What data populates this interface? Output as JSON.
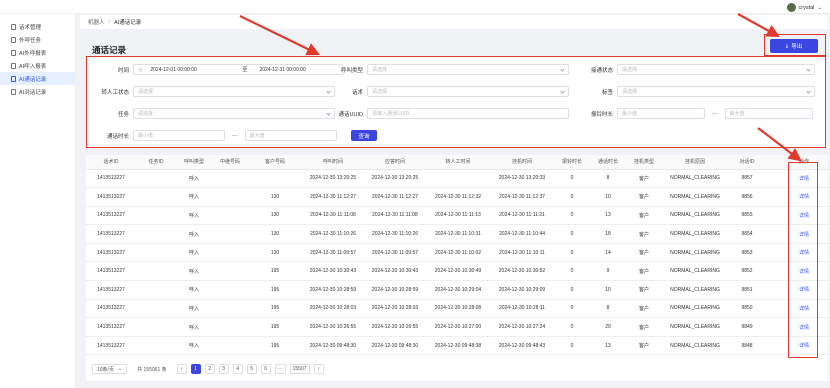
{
  "user": {
    "name": "crystal"
  },
  "sidebar": {
    "items": [
      {
        "label": "话术管理",
        "active": false
      },
      {
        "label": "外呼任务",
        "active": false
      },
      {
        "label": "AI外呼报表",
        "active": false
      },
      {
        "label": "AI呼入报表",
        "active": false
      },
      {
        "label": "AI通话记录",
        "active": true
      },
      {
        "label": "AI对话记录",
        "active": false
      }
    ]
  },
  "breadcrumb": {
    "root": "机器人",
    "sep": "/",
    "current": "AI通话记录"
  },
  "page": {
    "title": "通话记录",
    "export_label": "导出"
  },
  "filters": {
    "time_label": "时间",
    "time_start": "2024-12-01 00:00:00",
    "time_to": "至",
    "time_end": "2024-12-31 00:00:00",
    "call_type_label": "呼叫类型",
    "call_type_ph": "请选择",
    "connect_state_label": "接通状态",
    "connect_state_ph": "请选择",
    "transfer_state_label": "转人工状态",
    "transfer_state_ph": "请选择",
    "script_label": "话术",
    "script_ph": "请选择",
    "tag_label": "标签",
    "tag_ph": "请选择",
    "task_label": "任务",
    "task_ph": "请选择",
    "uuid_label": "通话UUID",
    "uuid_ph": "请输入通话UUID",
    "ring_label": "振铃时长",
    "ring_min_ph": "最小值",
    "ring_max_ph": "最大值",
    "dash": "—",
    "duration_label": "通话时长",
    "dur_min_ph": "最小值",
    "dur_max_ph": "最大值",
    "query_label": "查询"
  },
  "table": {
    "headers": [
      "话术ID",
      "任务ID",
      "呼叫类型",
      "中继号码",
      "客户号码",
      "呼叫时间",
      "应答时间",
      "转人工时间",
      "挂机时间",
      "振铃时长",
      "通话时长",
      "挂机类型",
      "挂机原因",
      "对话ID",
      "",
      "操作"
    ],
    "rows": [
      [
        "1413513227",
        "",
        "呼入",
        "",
        "",
        "2024-12-30 13:20:25",
        "2024-12-30 13:20:25",
        "",
        "2024-12-30 13:20:33",
        "0",
        "8",
        "客户",
        "NORMAL_CLEARING",
        "9857",
        "",
        "详情"
      ],
      [
        "1413513227",
        "",
        "呼入",
        "",
        "130",
        "2024-12-30 11:12:27",
        "2024-12-30 11:12:27",
        "2024-12-30 11:12:32",
        "2024-12-30 11:12:37",
        "0",
        "10",
        "客户",
        "NORMAL_CLEARING",
        "9856",
        "",
        "详情"
      ],
      [
        "1413513227",
        "",
        "呼入",
        "",
        "130",
        "2024-12-30 11:11:08",
        "2024-12-30 11:11:08",
        "2024-12-30 11:11:13",
        "2024-12-30 11:11:21",
        "0",
        "13",
        "客户",
        "NORMAL_CLEARING",
        "9855",
        "",
        "详情"
      ],
      [
        "1413513227",
        "",
        "呼入",
        "",
        "130",
        "2024-12-30 11:10:26",
        "2024-12-30 11:10:26",
        "2024-12-30 11:10:31",
        "2024-12-30 11:10:44",
        "0",
        "18",
        "客户",
        "NORMAL_CLEARING",
        "9854",
        "",
        "详情"
      ],
      [
        "1413513227",
        "",
        "呼入",
        "",
        "130",
        "2024-12-30 11:09:57",
        "2024-12-30 11:09:57",
        "2024-12-30 11:10:02",
        "2024-12-30 11:10:11",
        "0",
        "14",
        "客户",
        "NORMAL_CLEARING",
        "9853",
        "",
        "详情"
      ],
      [
        "1413513227",
        "",
        "呼入",
        "",
        "195",
        "2024-12-30 10:30:43",
        "2024-12-30 10:30:43",
        "2024-12-30 10:30:49",
        "2024-12-30 10:30:52",
        "0",
        "9",
        "客户",
        "NORMAL_CLEARING",
        "9852",
        "",
        "详情"
      ],
      [
        "1413513227",
        "",
        "呼入",
        "",
        "195",
        "2024-12-30 10:28:59",
        "2024-12-30 10:28:59",
        "2024-12-30 10:29:04",
        "2024-12-30 10:29:09",
        "0",
        "10",
        "客户",
        "NORMAL_CLEARING",
        "9851",
        "",
        "详情"
      ],
      [
        "1413513227",
        "",
        "呼入",
        "",
        "195",
        "2024-12-30 10:28:03",
        "2024-12-30 10:28:03",
        "2024-12-30 10:28:08",
        "2024-12-30 10:28:11",
        "0",
        "8",
        "客户",
        "NORMAL_CLEARING",
        "9850",
        "",
        "详情"
      ],
      [
        "1413513227",
        "",
        "呼入",
        "",
        "195",
        "2024-12-30 10:26:55",
        "2024-12-30 10:26:55",
        "2024-12-30 10:27:00",
        "2024-12-30 10:27:24",
        "0",
        "29",
        "客户",
        "NORMAL_CLEARING",
        "9849",
        "",
        "详情"
      ],
      [
        "1413513227",
        "",
        "呼入",
        "",
        "195",
        "2024-12-30 09:48:30",
        "2024-12-30 09:48:30",
        "2024-12-30 09:48:38",
        "2024-12-30 09:48:43",
        "0",
        "13",
        "客户",
        "NORMAL_CLEARING",
        "9848",
        "",
        "详情"
      ]
    ]
  },
  "pagination": {
    "page_size": "10条/页",
    "total": "共 155061 条",
    "pages": [
      "1",
      "2",
      "3",
      "4",
      "5",
      "6"
    ],
    "ellipsis": "···",
    "last": "15507",
    "active": "1"
  },
  "colors": {
    "accent": "#3b45e0",
    "annotation": "#e03a2c"
  }
}
